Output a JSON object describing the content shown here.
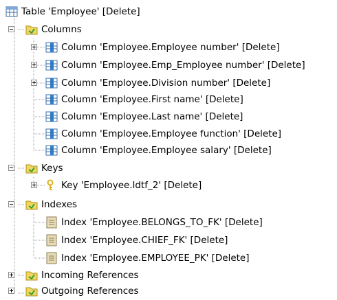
{
  "tree": {
    "root": {
      "label": "Table 'Employee' [Delete]",
      "icon": "table-icon"
    },
    "columns_folder": {
      "label": "Columns",
      "icon": "folder-icon"
    },
    "columns": [
      {
        "label": "Column 'Employee.Employee number' [Delete]",
        "expandable": true
      },
      {
        "label": "Column 'Employee.Emp_Employee number' [Delete]",
        "expandable": true
      },
      {
        "label": "Column 'Employee.Division number' [Delete]",
        "expandable": true
      },
      {
        "label": "Column 'Employee.First name' [Delete]",
        "expandable": false
      },
      {
        "label": "Column 'Employee.Last name' [Delete]",
        "expandable": false
      },
      {
        "label": "Column 'Employee.Employee function' [Delete]",
        "expandable": false
      },
      {
        "label": "Column 'Employee.Employee salary' [Delete]",
        "expandable": false
      }
    ],
    "keys_folder": {
      "label": "Keys",
      "icon": "folder-icon"
    },
    "keys": [
      {
        "label": "Key 'Employee.ldtf_2' [Delete]",
        "icon": "key-icon"
      }
    ],
    "indexes_folder": {
      "label": "Indexes",
      "icon": "folder-icon"
    },
    "indexes": [
      {
        "label": "Index 'Employee.BELONGS_TO_FK' [Delete]",
        "icon": "index-icon"
      },
      {
        "label": "Index 'Employee.CHIEF_FK' [Delete]",
        "icon": "index-icon"
      },
      {
        "label": "Index 'Employee.EMPLOYEE_PK' [Delete]",
        "icon": "index-icon"
      }
    ],
    "incoming_folder": {
      "label": "Incoming References",
      "icon": "folder-icon"
    },
    "outgoing_folder": {
      "label": "Outgoing References",
      "icon": "folder-icon"
    }
  },
  "colors": {
    "folder_yellow": "#f0d860",
    "folder_arrow": "#2e9e3a",
    "column_blue": "#2f7fd0",
    "key_gold": "#e0b020",
    "index_beige": "#e8ddb8",
    "connector": "#a0a0a0"
  }
}
